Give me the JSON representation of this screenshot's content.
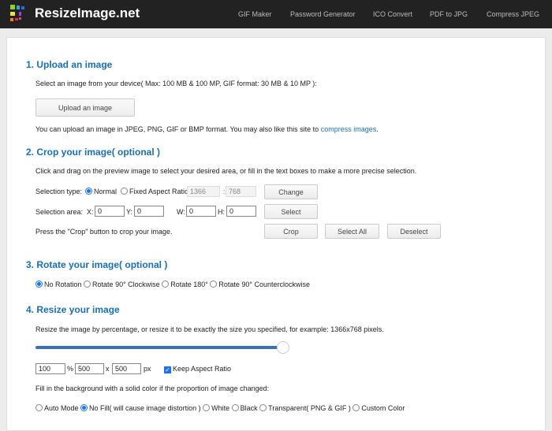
{
  "header": {
    "brand": "ResizeImage.net",
    "nav": [
      "GIF Maker",
      "Password Generator",
      "ICO Convert",
      "PDF to JPG",
      "Compress JPEG"
    ]
  },
  "s1": {
    "title": "1. Upload an image",
    "desc": "Select an image from your device( Max: 100 MB & 100 MP, GIF format: 30 MB & 10 MP ):",
    "upload": "Upload an image",
    "note": "You can upload an image in JPEG, PNG, GIF or BMP format. You may also like this site to ",
    "link": "compress images",
    "end": "."
  },
  "s2": {
    "title": "2. Crop your image( optional )",
    "desc": "Click and drag on the preview image to select your desired area, or fill in the text boxes to make a more precise selection.",
    "type_label": "Selection type:",
    "normal": "Normal",
    "fixed": "Fixed Aspect Ratio",
    "ratio_w": "1366",
    "colon": ":",
    "ratio_h": "768",
    "change": "Change",
    "area_label": "Selection area:",
    "x": "X:",
    "y": "Y:",
    "w": "W:",
    "h": "H:",
    "xv": "0",
    "yv": "0",
    "wv": "0",
    "hv": "0",
    "select": "Select",
    "press": "Press the \"Crop\" button to crop your image.",
    "crop": "Crop",
    "select_all": "Select All",
    "deselect": "Deselect"
  },
  "s3": {
    "title": "3. Rotate your image( optional )",
    "options": [
      "No Rotation",
      "Rotate 90° Clockwise",
      "Rotate 180°",
      "Rotate 90° Counterclockwise"
    ]
  },
  "s4": {
    "title": "4. Resize your image",
    "desc": "Resize the image by percentage, or resize it to be exactly the size you specified, for example: 1366x768 pixels.",
    "slider_percent": 100,
    "percent": "100",
    "pct": "%",
    "width": "500",
    "x": "x",
    "height": "500",
    "px": "px",
    "keep": "Keep Aspect Ratio",
    "fill_desc": "Fill in the background with a solid color if the proportion of image changed:",
    "fill_options": [
      "Auto Mode",
      "No Fill( will cause image distortion )",
      "White",
      "Black",
      "Transparent( PNG & GIF )",
      "Custom Color"
    ]
  },
  "colors": {
    "accent": "#1a6fb0",
    "slider": "#3b6fb6"
  }
}
